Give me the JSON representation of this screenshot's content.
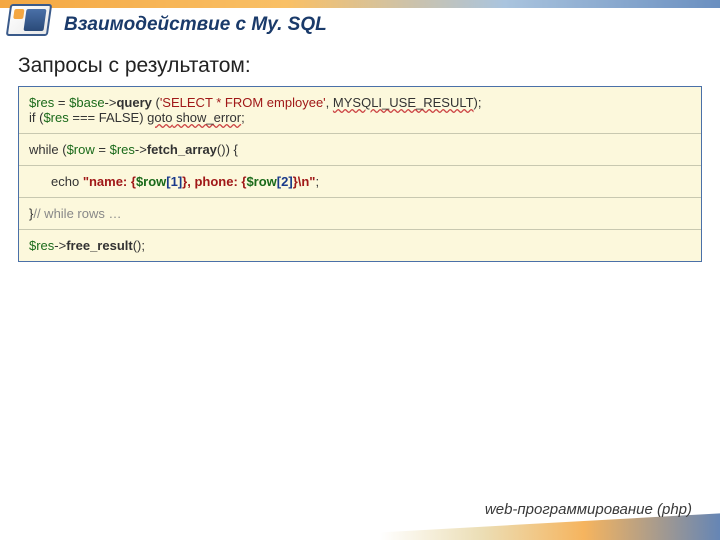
{
  "header": {
    "title": "Взаимодействие с My. SQL",
    "subtitle": "Запросы с результатом:"
  },
  "code": {
    "l1_res": "$res",
    "l1_eq": " = ",
    "l1_base": "$base",
    "l1_arrow": "->",
    "l1_query": "query",
    "l1_open": " (",
    "l1_str": "'SELECT * FROM employee'",
    "l1_comma": ", ",
    "l1_const": "MYSQLI_USE_RESULT",
    "l1_close": ");",
    "l2_if": "if (",
    "l2_res": "$res",
    "l2_cmp": " === FALSE) ",
    "l2_goto": "goto",
    "l2_label": " show_error",
    "l2_semi": ";",
    "l3_while": "while (",
    "l3_row": "$row",
    "l3_eq": " = ",
    "l3_res": "$res",
    "l3_arrow": "->",
    "l3_fetch": "fetch_array",
    "l3_close": "()) {",
    "l4_echo": "echo ",
    "l4_str1": "\"name: {",
    "l4_row1": "$row",
    "l4_idx1": "[1]",
    "l4_str2": "}, phone: {",
    "l4_row2": "$row",
    "l4_idx2": "[2]",
    "l4_str3": "}\\n\"",
    "l4_semi": ";",
    "l5_close": "}",
    "l5_comment": "// while rows …",
    "l6_res": "$res",
    "l6_arrow": "->",
    "l6_free": "free_result",
    "l6_call": "();"
  },
  "footer": {
    "text": "web-программирование (php)"
  }
}
